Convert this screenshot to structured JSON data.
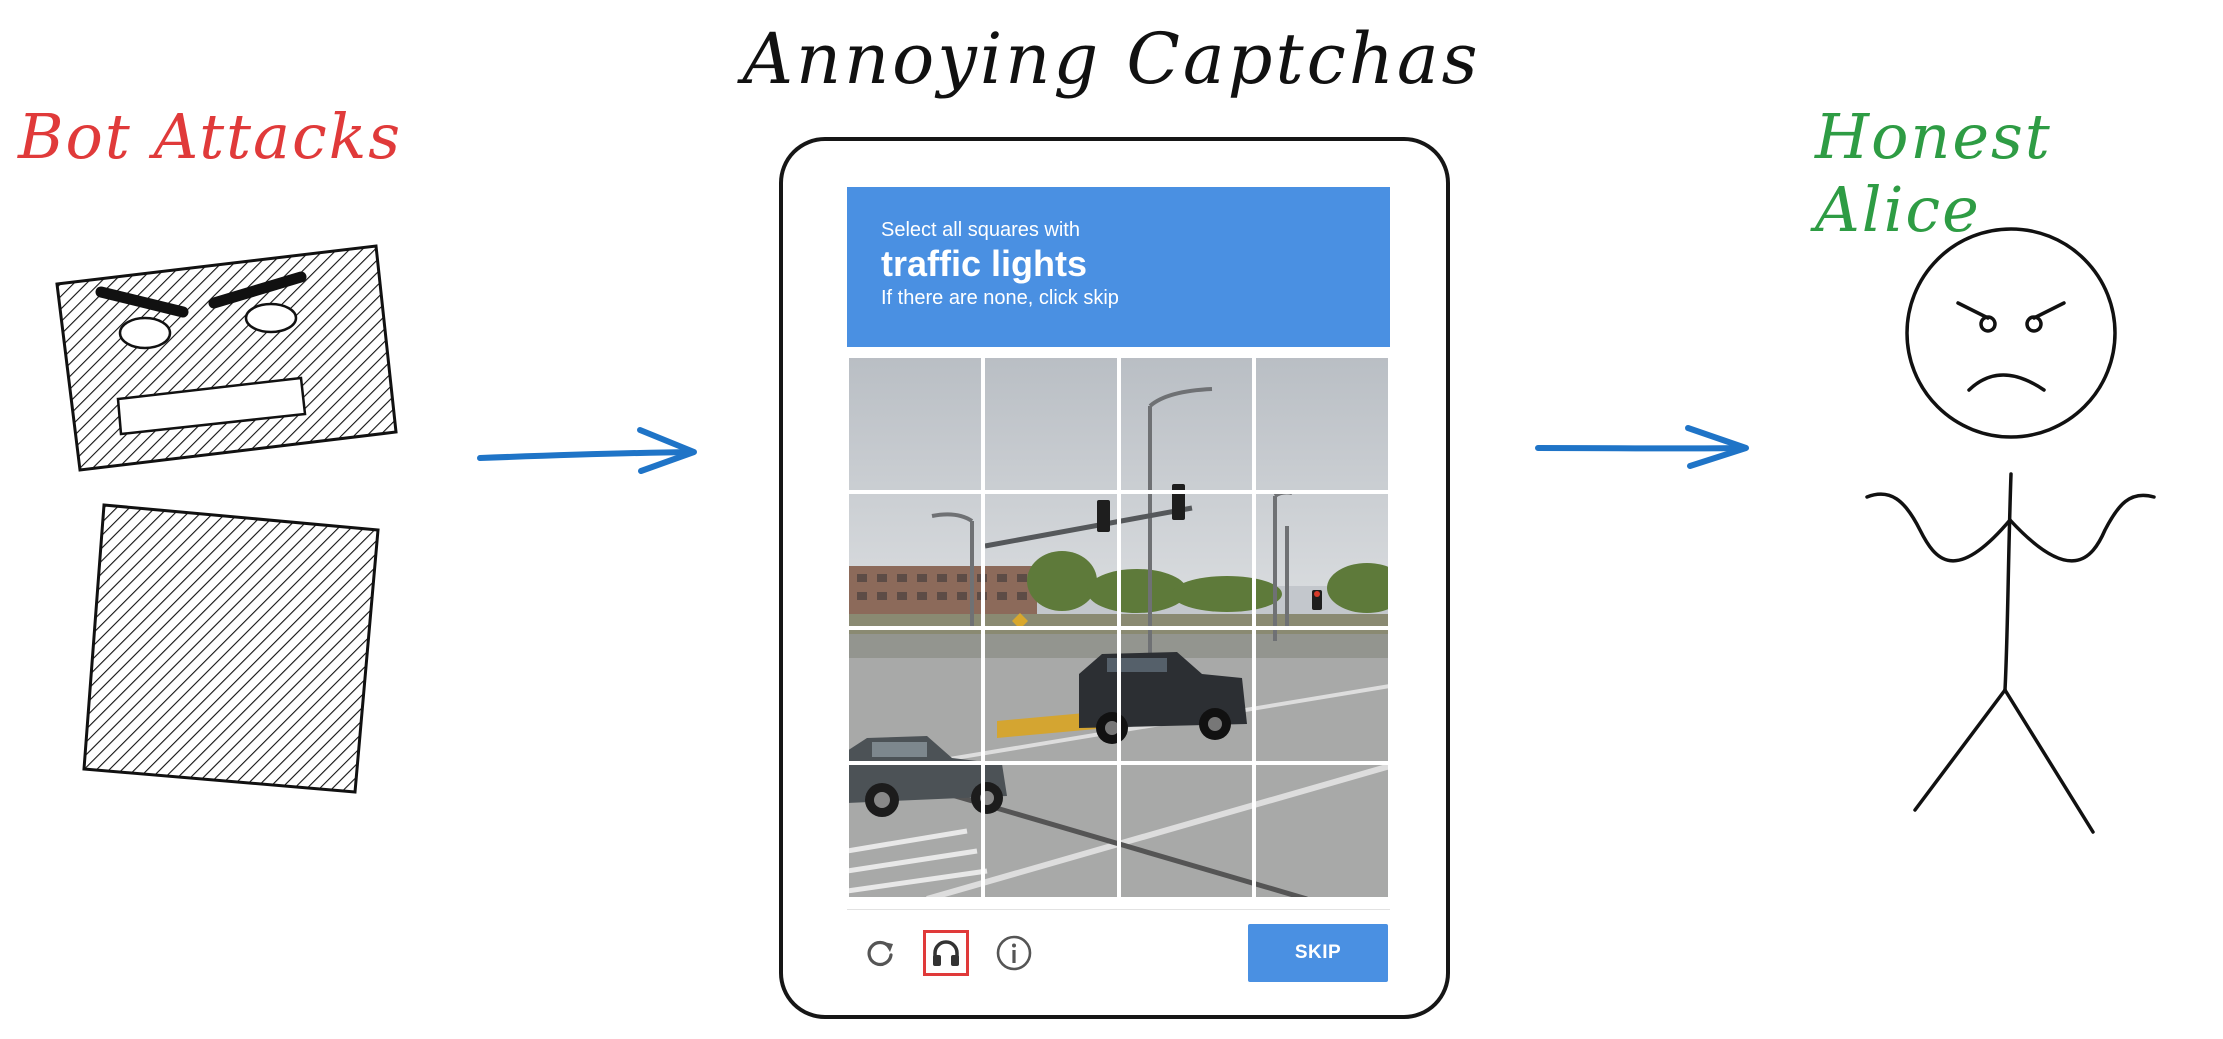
{
  "titles": {
    "main": "Annoying Captchas",
    "bot": "Bot Attacks",
    "alice": "Honest Alice"
  },
  "colors": {
    "bot_label": "#e03a3a",
    "alice_label": "#2e9c44",
    "arrow": "#1f74c7",
    "captcha_blue": "#4a90e2",
    "highlight_border": "#e03a3a"
  },
  "captcha": {
    "instruction": "Select all squares with",
    "target": "traffic lights",
    "hint": "If there are none, click skip",
    "grid": {
      "rows": 4,
      "cols": 4
    },
    "footer_icons": [
      "reload-icon",
      "headphones-icon",
      "info-icon"
    ],
    "skip_label": "SKIP"
  }
}
